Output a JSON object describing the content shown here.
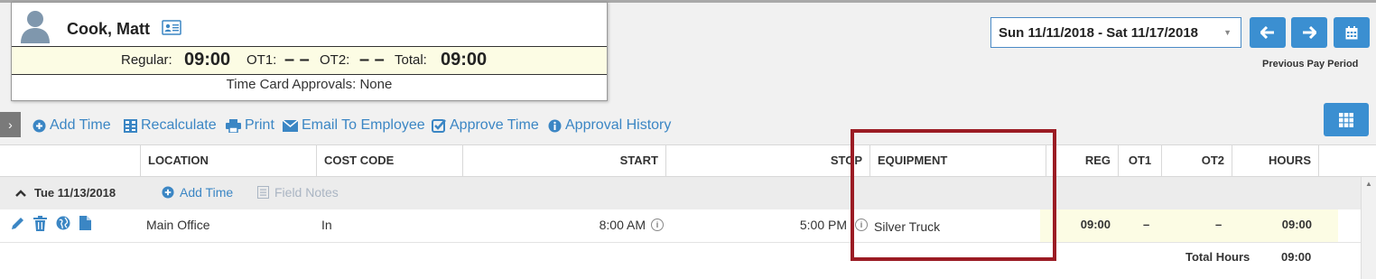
{
  "employee": {
    "name": "Cook, Matt",
    "regular_label": "Regular:",
    "regular_value": "09:00",
    "ot1_label": "OT1:",
    "ot1_value": "– –",
    "ot2_label": "OT2:",
    "ot2_value": "– –",
    "total_label": "Total:",
    "total_value": "09:00",
    "approvals": "Time Card Approvals: None"
  },
  "period": {
    "selected": "Sun 11/11/2018 - Sat 11/17/2018",
    "prev_label": "Previous Pay Period"
  },
  "toolbar": {
    "add_time": "Add Time",
    "recalculate": "Recalculate",
    "print": "Print",
    "email": "Email To Employee",
    "approve": "Approve Time",
    "history": "Approval History"
  },
  "table": {
    "columns": [
      "LOCATION",
      "COST CODE",
      "START",
      "STOP",
      "EQUIPMENT",
      "REG",
      "OT1",
      "OT2",
      "HOURS"
    ],
    "group": {
      "date": "Tue 11/13/2018",
      "add_time": "Add Time",
      "field_notes": "Field Notes"
    },
    "row": {
      "location": "Main Office",
      "cost_code": "In",
      "start": "8:00 AM",
      "stop": "5:00 PM",
      "equipment": "Silver Truck",
      "reg": "09:00",
      "ot1": "–",
      "ot2": "–",
      "hours": "09:00"
    },
    "total_label": "Total Hours",
    "total_value": "09:00"
  },
  "colors": {
    "accent": "#3b8fd1",
    "highlight": "#9b1c24",
    "row_highlight": "#fcfce4"
  }
}
